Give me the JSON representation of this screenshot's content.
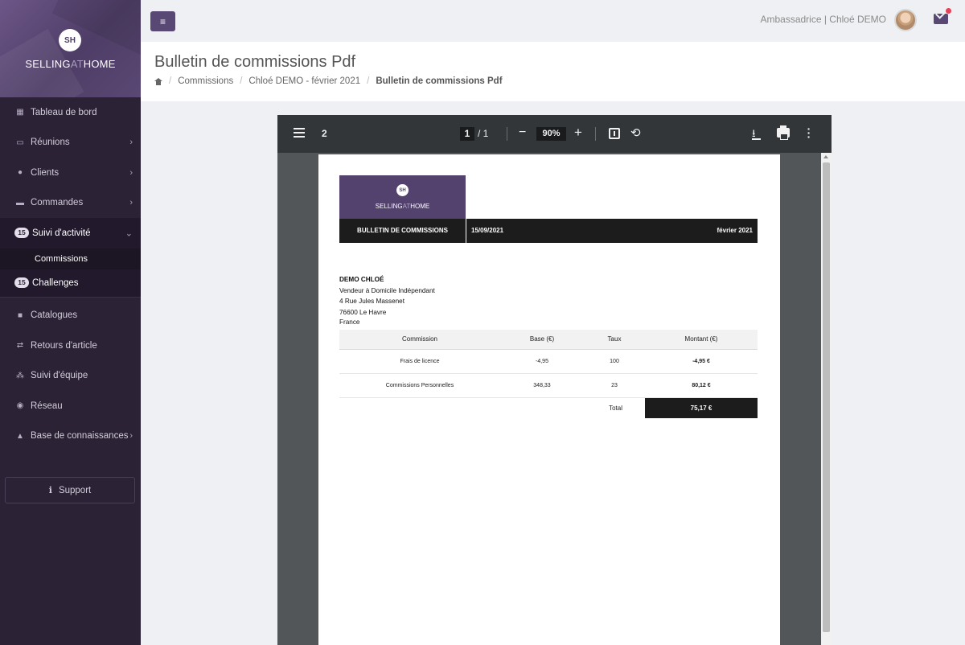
{
  "brand": {
    "logo_text": "SH",
    "name_part1": "SELLING",
    "name_at": "AT",
    "name_part2": "HOME"
  },
  "sidebar": {
    "items": [
      {
        "label": "Tableau de bord"
      },
      {
        "label": "Réunions"
      },
      {
        "label": "Clients"
      },
      {
        "label": "Commandes"
      },
      {
        "label": "Suivi d'activité",
        "badge": "15"
      },
      {
        "label": "Commissions"
      },
      {
        "label": "Challenges",
        "badge": "15"
      },
      {
        "label": "Catalogues"
      },
      {
        "label": "Retours d'article"
      },
      {
        "label": "Suivi d'équipe"
      },
      {
        "label": "Réseau"
      },
      {
        "label": "Base de connaissances"
      }
    ],
    "support_label": "Support"
  },
  "topbar": {
    "user_label": "Ambassadrice | Chloé DEMO"
  },
  "header": {
    "title": "Bulletin de commissions Pdf",
    "breadcrumb": [
      "Commissions",
      "Chloé DEMO - février 2021",
      "Bulletin de commissions Pdf"
    ]
  },
  "viewer": {
    "doc_number": "2",
    "current_page": "1",
    "total_pages": "/ 1",
    "zoom": "90%"
  },
  "document": {
    "logo_text": "SH",
    "brand_part1": "SELLING",
    "brand_at": "AT",
    "brand_part2": "HOME",
    "bar_title": "BULLETIN DE COMMISSIONS",
    "date": "15/09/2021",
    "period": "février 2021",
    "recipient": {
      "name": "DEMO CHLOÉ",
      "role": "Vendeur à Domicile Indépendant",
      "street": "4 Rue Jules Massenet",
      "city": "76600 Le Havre",
      "country": "France"
    },
    "table": {
      "headers": [
        "Commission",
        "Base (€)",
        "Taux",
        "Montant (€)"
      ],
      "rows": [
        {
          "commission": "Frais de licence",
          "base": "-4,95",
          "taux": "100",
          "montant": "-4,95 €"
        },
        {
          "commission": "Commissions Personnelles",
          "base": "348,33",
          "taux": "23",
          "montant": "80,12 €"
        }
      ],
      "total_label": "Total",
      "total_value": "75,17 €"
    }
  }
}
